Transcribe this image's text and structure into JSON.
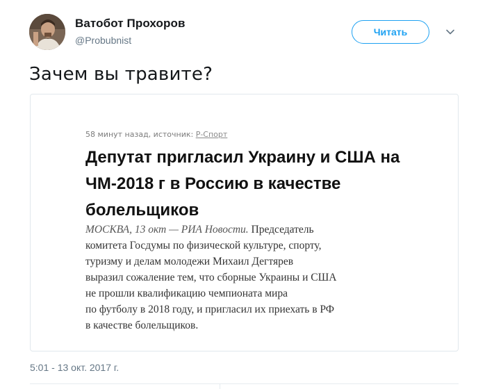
{
  "tweet": {
    "author_name": "Ватобот Прохоров",
    "author_handle": "@Probubnist",
    "follow_label": "Читать",
    "text": "Зачем вы травите?",
    "timestamp": "5:01 - 13 окт. 2017 г."
  },
  "card": {
    "meta_prefix": "58 минут назад, источник: ",
    "meta_source": "Р-Спорт",
    "title": "Депутат пригласил Украину и США на ЧМ-2018 г в Россию в качестве болельщиков",
    "body_lead": "МОСКВА, 13 окт — РИА Новости.",
    "body_lines": [
      " Председатель",
      "комитета Госдумы по физической культуре, спорту,",
      "туризму и делам молодежи Михаил Дегтярев",
      "выразил сожаление тем, что сборные Украины и США",
      "не прошли квалификацию чемпионата мира",
      "по футболу в 2018 году, и пригласил их приехать в РФ",
      "в качестве болельщиков."
    ]
  },
  "icons": {
    "caret": "chevron-down-icon",
    "avatar": "user-avatar"
  },
  "colors": {
    "accent": "#1da1f2",
    "muted": "#657786",
    "border": "#e1e8ed"
  }
}
